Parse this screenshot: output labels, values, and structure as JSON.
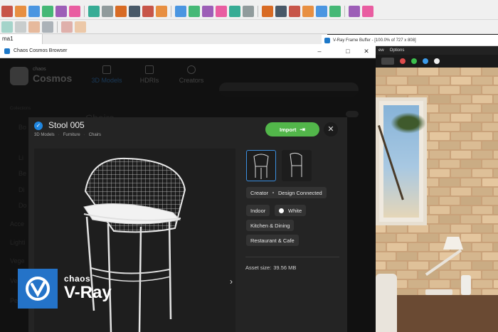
{
  "sketchup": {
    "tab_label": "ma1",
    "toolbar_icons": [
      "select-icon",
      "eraser-icon",
      "pencil-icon",
      "arc-icon",
      "shape-icon",
      "pushpull-icon",
      "move-icon",
      "rotate-icon",
      "scale-icon",
      "offset-icon",
      "tape-icon",
      "text-icon",
      "orbit-icon",
      "pan-icon",
      "zoom-icon",
      "zoom-extents-icon",
      "component-icon",
      "layer-icon",
      "warehouse-icon",
      "extension-icon",
      "user-icon",
      "style-icon",
      "iso-icon",
      "top-icon",
      "front-icon",
      "right-icon",
      "back-icon",
      "left-icon",
      "xray-icon",
      "wireframe-icon",
      "hidden-line-icon",
      "shaded-icon"
    ]
  },
  "vfb": {
    "title": "V-Ray Frame Buffer - [100.0% of 727 x 808]",
    "menu": [
      "ew",
      "Options"
    ],
    "colors": [
      "#dd4b4b",
      "#3cbf4c",
      "#3d9be9",
      "#eeeeee"
    ]
  },
  "cosmos": {
    "window_title": "Chaos Cosmos Browser",
    "logo_small": "chaos",
    "logo": "Cosmos",
    "nav_tabs": [
      "3D Models",
      "HDRIs",
      "Creators"
    ],
    "sidebar_items": [
      "Collections",
      "Bo",
      "Li",
      "Be",
      "Di",
      "Do",
      "Acce",
      "Lighti",
      "Vege",
      "Vehic",
      "Pe"
    ],
    "heading": "Chairs",
    "modal": {
      "title": "Stool 005",
      "breadcrumbs": [
        "3D Models",
        "Furniture",
        "Chairs"
      ],
      "import_label": "Import",
      "close_symbol": "✕",
      "tags": {
        "creator_label": "Creator",
        "creator_name": "Design Connected",
        "indoor": "Indoor",
        "white": "White",
        "kitchen": "Kitchen & Dining",
        "restaurant": "Restaurant & Cafe"
      },
      "asset_size_label": "Asset size:",
      "asset_size_value": "39.56 MB",
      "chevron": "›"
    }
  },
  "brand": {
    "small": "chaos",
    "big": "V-Ray",
    "color": "#2473c8"
  }
}
